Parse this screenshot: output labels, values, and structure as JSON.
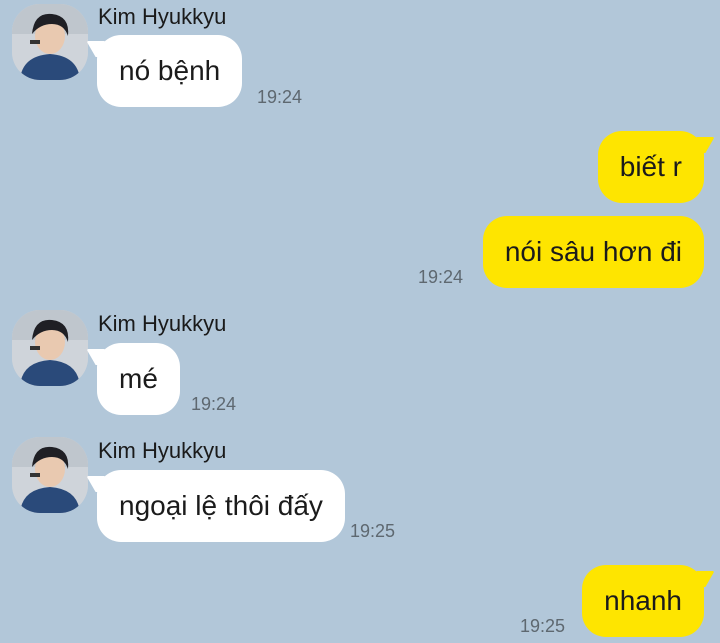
{
  "colors": {
    "background": "#b2c7d9",
    "incoming_bubble": "#ffffff",
    "outgoing_bubble": "#fee500"
  },
  "messages": [
    {
      "sender": "Kim Hyukkyu",
      "text": "nó bệnh",
      "time": "19:24",
      "direction": "incoming",
      "avatar": "user-avatar-icon"
    },
    {
      "text": "biết r",
      "direction": "outgoing"
    },
    {
      "text": "nói sâu hơn đi",
      "time": "19:24",
      "direction": "outgoing"
    },
    {
      "sender": "Kim Hyukkyu",
      "text": "mé",
      "time": "19:24",
      "direction": "incoming",
      "avatar": "user-avatar-icon"
    },
    {
      "sender": "Kim Hyukkyu",
      "text": "ngoại lệ thôi đấy",
      "time": "19:25",
      "direction": "incoming",
      "avatar": "user-avatar-icon"
    },
    {
      "text": "nhanh",
      "time": "19:25",
      "direction": "outgoing"
    }
  ]
}
